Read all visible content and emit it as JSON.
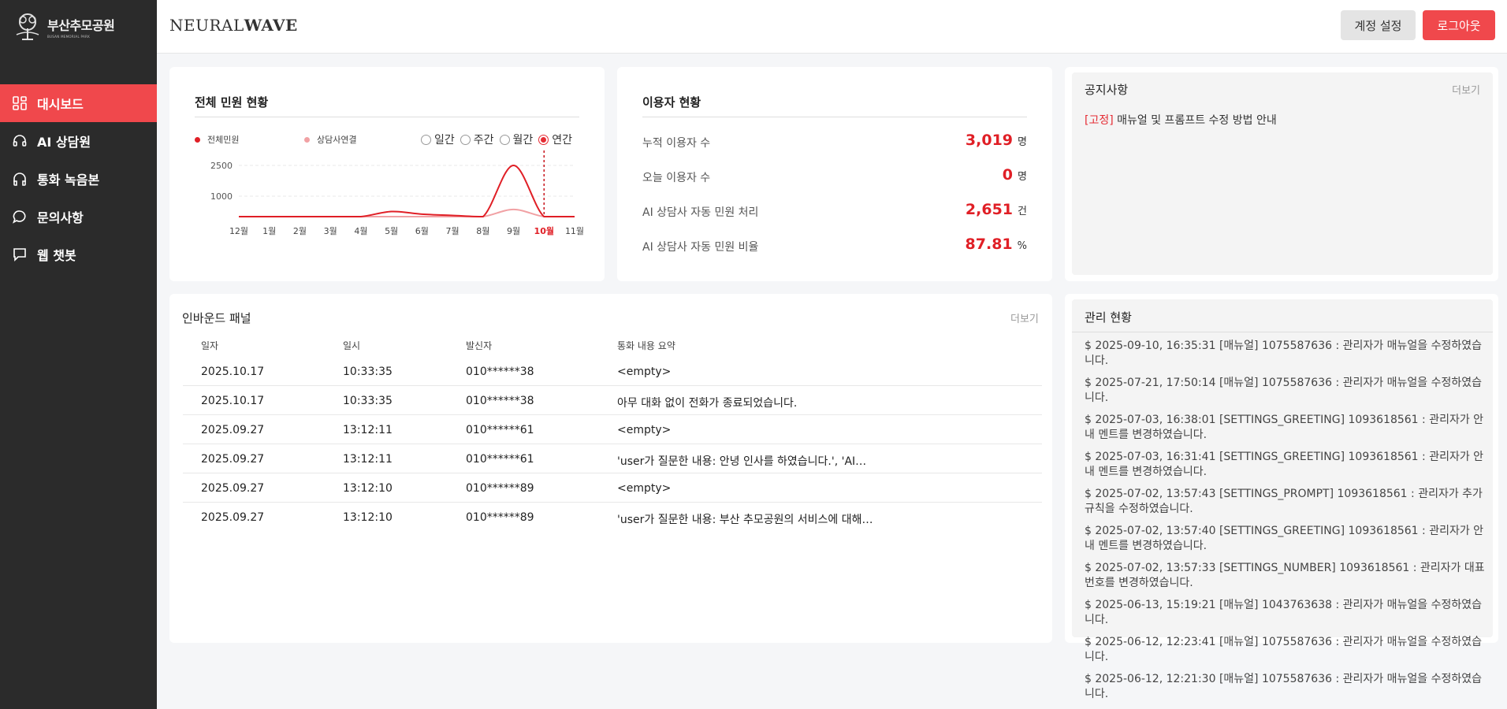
{
  "logo": {
    "name": "부산추모공원",
    "subtitle": "BUSAN MEMORIAL PARK"
  },
  "brand": {
    "light": "NEURAL",
    "bold": "WAVE"
  },
  "header": {
    "settings_label": "계정 설정",
    "logout_label": "로그아웃"
  },
  "sidebar": {
    "items": [
      {
        "label": "대시보드",
        "icon": "dashboard-icon",
        "active": true
      },
      {
        "label": "AI 상담원",
        "icon": "headset-icon",
        "active": false
      },
      {
        "label": "통화 녹음본",
        "icon": "headphones-icon",
        "active": false
      },
      {
        "label": "문의사항",
        "icon": "chat-bubble-icon",
        "active": false
      },
      {
        "label": "웹 챗봇",
        "icon": "message-square-icon",
        "active": false
      }
    ]
  },
  "complaints": {
    "title": "전체 민원 현황",
    "legend": [
      "전체민원",
      "상담사연결"
    ],
    "periods": [
      "일간",
      "주간",
      "월간",
      "연간"
    ],
    "selected_period": "연간"
  },
  "chart_data": {
    "type": "line",
    "categories": [
      "12월",
      "1월",
      "2월",
      "3월",
      "4월",
      "5월",
      "6월",
      "7월",
      "8월",
      "9월",
      "10월",
      "11월"
    ],
    "highlight": "10월",
    "ylim": [
      0,
      3000
    ],
    "yticks": [
      1000,
      2500
    ],
    "grid": true,
    "series": [
      {
        "name": "전체민원",
        "color": "#e01f26",
        "values": [
          0,
          0,
          0,
          0,
          0,
          250,
          120,
          60,
          0,
          2500,
          0,
          0
        ]
      },
      {
        "name": "상담사연결",
        "color": "#f1a1a4",
        "values": [
          0,
          0,
          0,
          0,
          0,
          0,
          0,
          0,
          0,
          350,
          0,
          0
        ]
      }
    ]
  },
  "users": {
    "title": "이용자 현황",
    "stats": [
      {
        "label": "누적 이용자 수",
        "value": "3,019",
        "unit": "명"
      },
      {
        "label": "오늘 이용자 수",
        "value": "0",
        "unit": "명"
      },
      {
        "label": "AI 상담사 자동 민원 처리",
        "value": "2,651",
        "unit": "건"
      },
      {
        "label": "AI 상담사 자동 민원 비율",
        "value": "87.81",
        "unit": "%"
      }
    ]
  },
  "notice": {
    "title": "공지사항",
    "more": "더보기",
    "items": [
      {
        "tag": "[고정]",
        "text": "매뉴얼 및 프롬프트 수정 방법 안내"
      }
    ]
  },
  "inbound": {
    "title": "인바운드 패널",
    "more": "더보기",
    "columns": [
      "일자",
      "일시",
      "발신자",
      "통화 내용 요약"
    ],
    "rows": [
      [
        "2025.10.17",
        "10:33:35",
        "010******38",
        "<empty>"
      ],
      [
        "2025.10.17",
        "10:33:35",
        "010******38",
        "아무 대화 없이 전화가 종료되었습니다."
      ],
      [
        "2025.09.27",
        "13:12:11",
        "010******61",
        "<empty>"
      ],
      [
        "2025.09.27",
        "13:12:11",
        "010******61",
        "'user가 질문한 내용: 안녕 인사를 하였습니다.', 'AI…"
      ],
      [
        "2025.09.27",
        "13:12:10",
        "010******89",
        "<empty>"
      ],
      [
        "2025.09.27",
        "13:12:10",
        "010******89",
        "'user가 질문한 내용: 부산 추모공원의 서비스에 대해…"
      ]
    ]
  },
  "management": {
    "title": "관리 현황",
    "logs": [
      "$ 2025-09-10, 16:35:31 [매뉴얼] 1075587636 : 관리자가 매뉴얼을 수정하였습니다.",
      "$ 2025-07-21, 17:50:14 [매뉴얼] 1075587636 : 관리자가 매뉴얼을 수정하였습니다.",
      "$ 2025-07-03, 16:38:01 [SETTINGS_GREETING] 1093618561 : 관리자가 안내 멘트를 변경하였습니다.",
      "$ 2025-07-03, 16:31:41 [SETTINGS_GREETING] 1093618561 : 관리자가 안내 멘트를 변경하였습니다.",
      "$ 2025-07-02, 13:57:43 [SETTINGS_PROMPT] 1093618561 : 관리자가 추가 규칙을 수정하였습니다.",
      "$ 2025-07-02, 13:57:40 [SETTINGS_GREETING] 1093618561 : 관리자가 안내 멘트를 변경하였습니다.",
      "$ 2025-07-02, 13:57:33 [SETTINGS_NUMBER] 1093618561 : 관리자가 대표 번호를 변경하였습니다.",
      "$ 2025-06-13, 15:19:21 [매뉴얼] 1043763638 : 관리자가 매뉴얼을 수정하였습니다.",
      "$ 2025-06-12, 12:23:41 [매뉴얼] 1075587636 : 관리자가 매뉴얼을 수정하였습니다.",
      "$ 2025-06-12, 12:21:30 [매뉴얼] 1075587636 : 관리자가 매뉴얼을 수정하였습니다."
    ]
  }
}
